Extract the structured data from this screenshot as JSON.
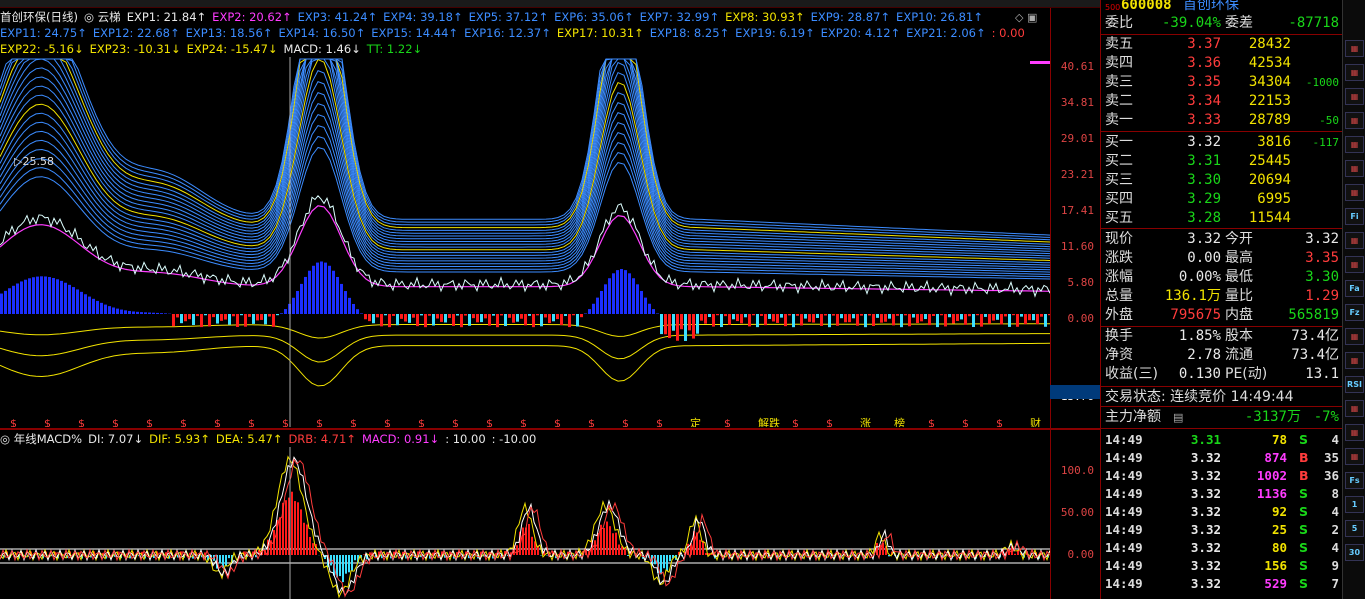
{
  "chart_legend": {
    "row1": [
      {
        "label": "首创环保(日线)",
        "color": "#e8e8e8"
      },
      {
        "label": "◎ 云梯",
        "color": "#e8e8e8"
      },
      {
        "label": "EXP1: 21.84↑",
        "color": "#e8e8e8"
      },
      {
        "label": "EXP2: 20.62↑",
        "color": "#ff3cff"
      },
      {
        "label": "EXP3: 41.24↑",
        "color": "#3c8cff"
      },
      {
        "label": "EXP4: 39.18↑",
        "color": "#3c8cff"
      },
      {
        "label": "EXP5: 37.12↑",
        "color": "#3c8cff"
      },
      {
        "label": "EXP6: 35.06↑",
        "color": "#3c8cff"
      },
      {
        "label": "EXP7: 32.99↑",
        "color": "#3c8cff"
      },
      {
        "label": "EXP8: 30.93↑",
        "color": "#f2e300"
      },
      {
        "label": "EXP9: 28.87↑",
        "color": "#3c8cff"
      },
      {
        "label": "EXP10: 26.81↑",
        "color": "#3c8cff"
      }
    ],
    "row2": [
      {
        "label": "EXP11: 24.75↑",
        "color": "#3c8cff"
      },
      {
        "label": "EXP12: 22.68↑",
        "color": "#3c8cff"
      },
      {
        "label": "EXP13: 18.56↑",
        "color": "#3c8cff"
      },
      {
        "label": "EXP14: 16.50↑",
        "color": "#3c8cff"
      },
      {
        "label": "EXP15: 14.44↑",
        "color": "#3c8cff"
      },
      {
        "label": "EXP16: 12.37↑",
        "color": "#3c8cff"
      },
      {
        "label": "EXP17: 10.31↑",
        "color": "#f2e300"
      },
      {
        "label": "EXP18: 8.25↑",
        "color": "#3c8cff"
      },
      {
        "label": "EXP19: 6.19↑",
        "color": "#3c8cff"
      },
      {
        "label": "EXP20: 4.12↑",
        "color": "#3c8cff"
      },
      {
        "label": "EXP21: 2.06↑",
        "color": "#3c8cff"
      },
      {
        "label": ": 0.00",
        "color": "#ff3c3c"
      }
    ],
    "row3": [
      {
        "label": "EXP22: -5.16↓",
        "color": "#f2e300"
      },
      {
        "label": "EXP23: -10.31↓",
        "color": "#f2e300"
      },
      {
        "label": "EXP24: -15.47↓",
        "color": "#f2e300"
      },
      {
        "label": "MACD: 1.46↓",
        "color": "#e8e8e8"
      },
      {
        "label": "TT: 1.22↓",
        "color": "#19d619"
      }
    ]
  },
  "ohlc_note": "▷25.58",
  "axis1": {
    "ticks": [
      "40.61",
      "34.81",
      "29.01",
      "23.21",
      "17.41",
      "11.60",
      "5.80",
      "0.00",
      "-13.76"
    ]
  },
  "lower_legend": [
    {
      "label": "◎ 年线MACD%",
      "color": "#e8e8e8"
    },
    {
      "label": "DI: 7.07↓",
      "color": "#e8e8e8"
    },
    {
      "label": "DIF: 5.93↑",
      "color": "#f2e300"
    },
    {
      "label": "DEA: 5.47↑",
      "color": "#f2e300"
    },
    {
      "label": "DRB: 4.71↑",
      "color": "#ff3c3c"
    },
    {
      "label": "MACD: 0.91↓",
      "color": "#ff3cff"
    },
    {
      "label": ": 10.00",
      "color": "#e8e8e8"
    },
    {
      "label": ": -10.00",
      "color": "#e8e8e8"
    }
  ],
  "axis2": {
    "ticks": [
      "100.0",
      "50.00",
      "0.00"
    ]
  },
  "signal_markers": [
    "$",
    "$",
    "$",
    "$",
    "$",
    "$",
    "$",
    "$",
    "$",
    "$",
    "$",
    "$",
    "$",
    "$",
    "$",
    "$",
    "$",
    "$",
    "$",
    "$",
    "定",
    "$",
    "解跌",
    "$",
    "$",
    "涨",
    "榜",
    "$",
    "$",
    "$",
    "财"
  ],
  "quote": {
    "header": {
      "code": "600008",
      "name": "首创环保",
      "small": "500"
    },
    "weibi": {
      "label": "委比",
      "value": "-39.04%",
      "label2": "委差",
      "value2": "-87718"
    },
    "asks": [
      {
        "label": "卖五",
        "price": "3.37",
        "vol": "28432",
        "chg": ""
      },
      {
        "label": "卖四",
        "price": "3.36",
        "vol": "42534",
        "chg": ""
      },
      {
        "label": "卖三",
        "price": "3.35",
        "vol": "34304",
        "chg": "-1000"
      },
      {
        "label": "卖二",
        "price": "3.34",
        "vol": "22153",
        "chg": ""
      },
      {
        "label": "卖一",
        "price": "3.33",
        "vol": "28789",
        "chg": "-50"
      }
    ],
    "bids": [
      {
        "label": "买一",
        "price": "3.32",
        "vol": "3816",
        "chg": "-117",
        "pcolor": "#e8e8e8"
      },
      {
        "label": "买二",
        "price": "3.31",
        "vol": "25445",
        "chg": "",
        "pcolor": "#19d619"
      },
      {
        "label": "买三",
        "price": "3.30",
        "vol": "20694",
        "chg": "",
        "pcolor": "#19d619"
      },
      {
        "label": "买四",
        "price": "3.29",
        "vol": "6995",
        "chg": "",
        "pcolor": "#19d619"
      },
      {
        "label": "买五",
        "price": "3.28",
        "vol": "11544",
        "chg": "",
        "pcolor": "#19d619"
      }
    ],
    "stats": [
      {
        "l1": "现价",
        "v1": "3.32",
        "c1": "#e8e8e8",
        "l2": "今开",
        "v2": "3.32",
        "c2": "#e8e8e8"
      },
      {
        "l1": "涨跌",
        "v1": "0.00",
        "c1": "#e8e8e8",
        "l2": "最高",
        "v2": "3.35",
        "c2": "#ff3c3c"
      },
      {
        "l1": "涨幅",
        "v1": "0.00%",
        "c1": "#e8e8e8",
        "l2": "最低",
        "v2": "3.30",
        "c2": "#19d619"
      },
      {
        "l1": "总量",
        "v1": "136.1万",
        "c1": "#f2e300",
        "l2": "量比",
        "v2": "1.29",
        "c2": "#ff3c3c"
      },
      {
        "l1": "外盘",
        "v1": "795675",
        "c1": "#ff3c3c",
        "l2": "内盘",
        "v2": "565819",
        "c2": "#19d619"
      },
      {
        "l1": "换手",
        "v1": "1.85%",
        "c1": "#e8e8e8",
        "l2": "股本",
        "v2": "73.4亿",
        "c2": "#e8e8e8"
      },
      {
        "l1": "净资",
        "v1": "2.78",
        "c1": "#e8e8e8",
        "l2": "流通",
        "v2": "73.4亿",
        "c2": "#e8e8e8"
      },
      {
        "l1": "收益(三)",
        "v1": "0.130",
        "c1": "#e8e8e8",
        "l2": "PE(动)",
        "v2": "13.1",
        "c2": "#e8e8e8"
      }
    ],
    "trade_status": "交易状态: 连续竞价 14:49:44",
    "main_flow": {
      "label": "主力净额",
      "value": "-3137万",
      "pct": "-7%"
    },
    "ticks": [
      {
        "t": "14:49",
        "p": "3.31",
        "v": "78",
        "s": "S",
        "n": "4",
        "pc": "#19d619",
        "vc": "#f2e300",
        "sc": "#19d619"
      },
      {
        "t": "14:49",
        "p": "3.32",
        "v": "874",
        "s": "B",
        "n": "35",
        "pc": "#e8e8e8",
        "vc": "#ff3cff",
        "sc": "#ff3c3c"
      },
      {
        "t": "14:49",
        "p": "3.32",
        "v": "1002",
        "s": "B",
        "n": "36",
        "pc": "#e8e8e8",
        "vc": "#ff3cff",
        "sc": "#ff3c3c"
      },
      {
        "t": "14:49",
        "p": "3.32",
        "v": "1136",
        "s": "S",
        "n": "8",
        "pc": "#e8e8e8",
        "vc": "#ff3cff",
        "sc": "#19d619"
      },
      {
        "t": "14:49",
        "p": "3.32",
        "v": "92",
        "s": "S",
        "n": "4",
        "pc": "#e8e8e8",
        "vc": "#f2e300",
        "sc": "#19d619"
      },
      {
        "t": "14:49",
        "p": "3.32",
        "v": "25",
        "s": "S",
        "n": "2",
        "pc": "#e8e8e8",
        "vc": "#f2e300",
        "sc": "#19d619"
      },
      {
        "t": "14:49",
        "p": "3.32",
        "v": "80",
        "s": "S",
        "n": "4",
        "pc": "#e8e8e8",
        "vc": "#f2e300",
        "sc": "#19d619"
      },
      {
        "t": "14:49",
        "p": "3.32",
        "v": "156",
        "s": "S",
        "n": "9",
        "pc": "#e8e8e8",
        "vc": "#f2e300",
        "sc": "#19d619"
      },
      {
        "t": "14:49",
        "p": "3.32",
        "v": "529",
        "s": "S",
        "n": "7",
        "pc": "#e8e8e8",
        "vc": "#ff3cff",
        "sc": "#19d619"
      }
    ]
  },
  "toolbar_icons": [
    "Fi",
    "Fa",
    "Fz",
    "RSI",
    "Fs",
    "1",
    "5",
    "30",
    "60"
  ]
}
